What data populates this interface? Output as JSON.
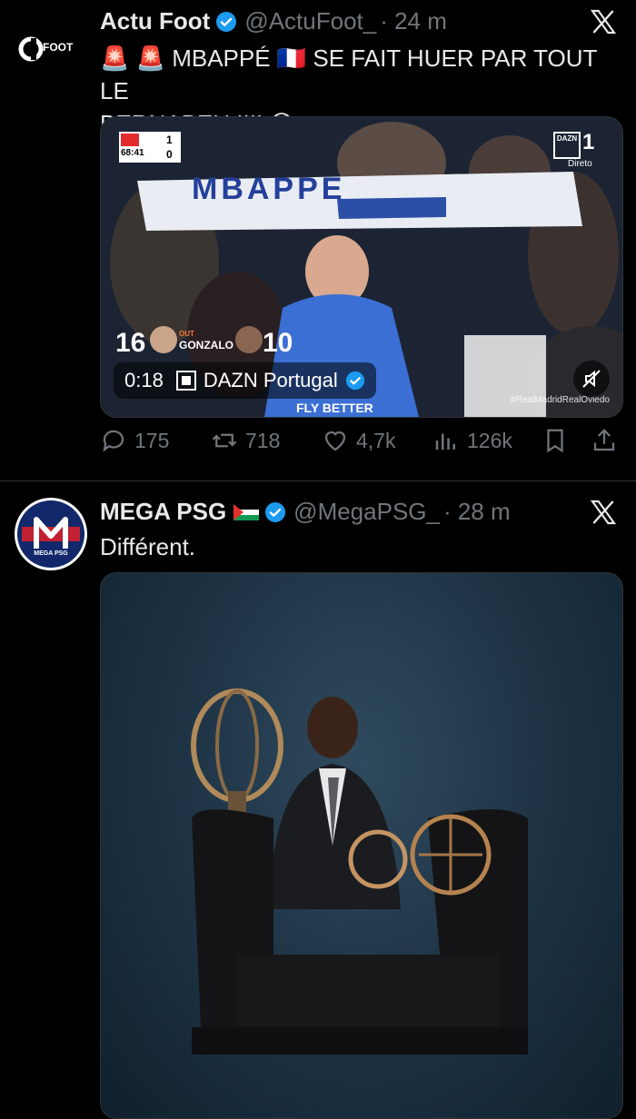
{
  "tweets": [
    {
      "name": "Actu Foot",
      "handle": "@ActuFoot_",
      "time": "· 24 m",
      "avatar_text": "FOOT",
      "text_line1": "🚨 🚨 MBAPPÉ 🇫🇷 SE FAIT HUER PAR TOUT LE",
      "text_line2": "BERNABEU !!!! 😳",
      "video": {
        "duration": "0:18",
        "source": "DAZN Portugal",
        "score_home": "1",
        "score_away": "0",
        "match_clock": "68:41",
        "dazn_label": "DAZN",
        "dazn_channel": "1",
        "direto": "Direto",
        "sub_out_number": "16",
        "sub_in_number": "10",
        "sub_out_label": "OUT",
        "sub_out_name": "GONZALO",
        "scarf_text": "MBAPPE",
        "hashtag": "#RealMadridRealOviedo",
        "shirt_text": "FLY BETTER"
      },
      "stats": {
        "replies": "175",
        "reposts": "718",
        "likes": "4,7k",
        "views": "126k"
      }
    },
    {
      "name": "MEGA PSG",
      "handle": "@MegaPSG_",
      "time": "· 28 m",
      "avatar_text": "MEGA PSG",
      "text_line1": "Différent."
    }
  ],
  "colors": {
    "verified": "#1d9bf0",
    "muted": "#71767b",
    "divider": "#2f3336"
  }
}
